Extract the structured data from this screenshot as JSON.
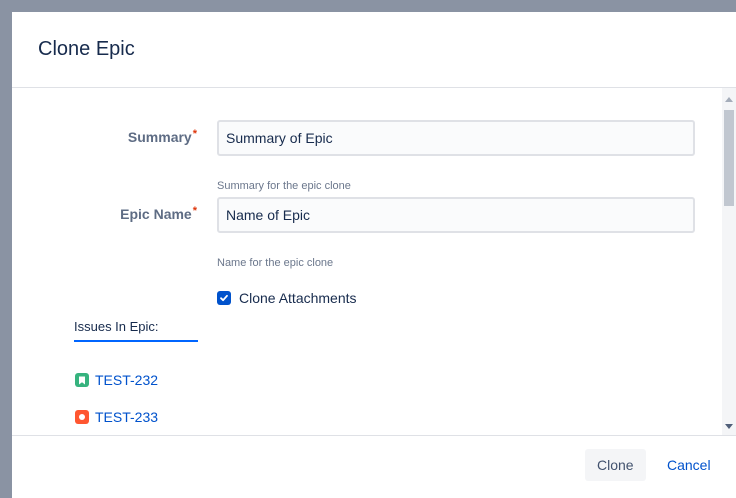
{
  "dialog": {
    "title": "Clone Epic"
  },
  "form": {
    "summary": {
      "label": "Summary",
      "required_mark": "*",
      "value": "Summary of Epic",
      "help": "Summary for the epic clone"
    },
    "epic_name": {
      "label": "Epic Name",
      "required_mark": "*",
      "value": "Name of Epic",
      "help": "Name for the epic clone"
    },
    "clone_attachments": {
      "label": "Clone Attachments",
      "checked": true
    }
  },
  "issues": {
    "heading": "Issues In Epic:",
    "items": [
      {
        "key": "TEST-232",
        "icon": "story-icon",
        "color": "#36b37e"
      },
      {
        "key": "TEST-233",
        "icon": "bug-icon",
        "color": "#ff5630"
      },
      {
        "key": "",
        "icon": "task-icon",
        "color": "#2684ff"
      }
    ]
  },
  "footer": {
    "clone_label": "Clone",
    "cancel_label": "Cancel"
  },
  "colors": {
    "primary": "#0052cc",
    "required": "#de350b",
    "backdrop": "#8a93a3"
  }
}
